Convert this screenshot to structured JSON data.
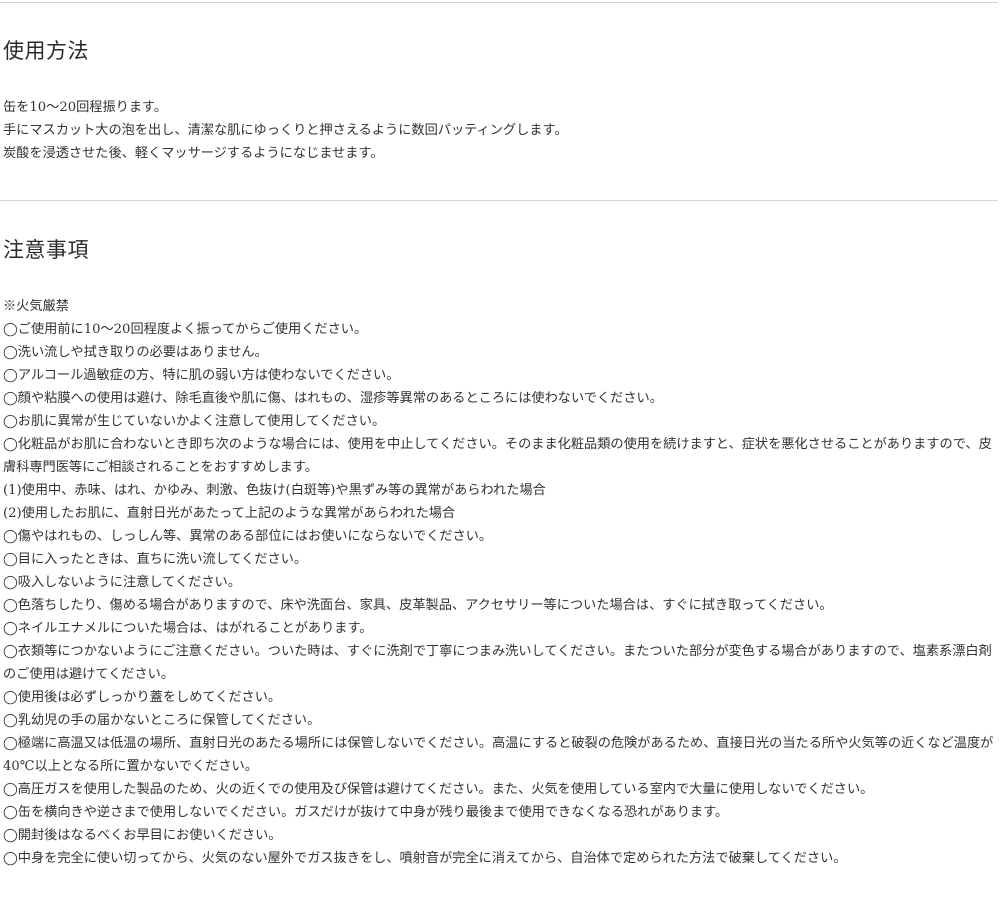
{
  "usage": {
    "title": "使用方法",
    "lines": [
      "缶を10～20回程振ります。",
      "手にマスカット大の泡を出し、清潔な肌にゆっくりと押さえるように数回パッティングします。",
      "炭酸を浸透させた後、軽くマッサージするようになじませます。"
    ]
  },
  "caution": {
    "title": "注意事項",
    "lines": [
      "※火気厳禁",
      "◯ご使用前に10～20回程度よく振ってからご使用ください。",
      "◯洗い流しや拭き取りの必要はありません。",
      "◯アルコール過敏症の方、特に肌の弱い方は使わないでください。",
      "◯顔や粘膜への使用は避け、除毛直後や肌に傷、はれもの、湿疹等異常のあるところには使わないでください。",
      "◯お肌に異常が生じていないかよく注意して使用してください。",
      "◯化粧品がお肌に合わないとき即ち次のような場合には、使用を中止してください。そのまま化粧品類の使用を続けますと、症状を悪化させることがありますので、皮膚科専門医等にご相談されることをおすすめします。",
      "(1)使用中、赤味、はれ、かゆみ、刺激、色抜け(白斑等)や黒ずみ等の異常があらわれた場合",
      "(2)使用したお肌に、直射日光があたって上記のような異常があらわれた場合",
      "◯傷やはれもの、しっしん等、異常のある部位にはお使いにならないでください。",
      "◯目に入ったときは、直ちに洗い流してください。",
      "◯吸入しないように注意してください。",
      "◯色落ちしたり、傷める場合がありますので、床や洗面台、家具、皮革製品、アクセサリー等についた場合は、すぐに拭き取ってください。",
      "◯ネイルエナメルについた場合は、はがれることがあります。",
      "◯衣類等につかないようにご注意ください。ついた時は、すぐに洗剤で丁寧につまみ洗いしてください。またついた部分が変色する場合がありますので、塩素系漂白剤のご使用は避けてください。",
      "◯使用後は必ずしっかり蓋をしめてください。",
      "◯乳幼児の手の届かないところに保管してください。",
      "◯極端に高温又は低温の場所、直射日光のあたる場所には保管しないでください。高温にすると破裂の危険があるため、直接日光の当たる所や火気等の近くなど温度が40℃以上となる所に置かないでください。",
      "◯高圧ガスを使用した製品のため、火の近くでの使用及び保管は避けてください。また、火気を使用している室内で大量に使用しないでください。",
      "◯缶を横向きや逆さまで使用しないでください。ガスだけが抜けて中身が残り最後まで使用できなくなる恐れがあります。",
      "◯開封後はなるべくお早目にお使いください。",
      "◯中身を完全に使い切ってから、火気のない屋外でガス抜きをし、噴射音が完全に消えてから、自治体で定められた方法で破棄してください。"
    ]
  }
}
